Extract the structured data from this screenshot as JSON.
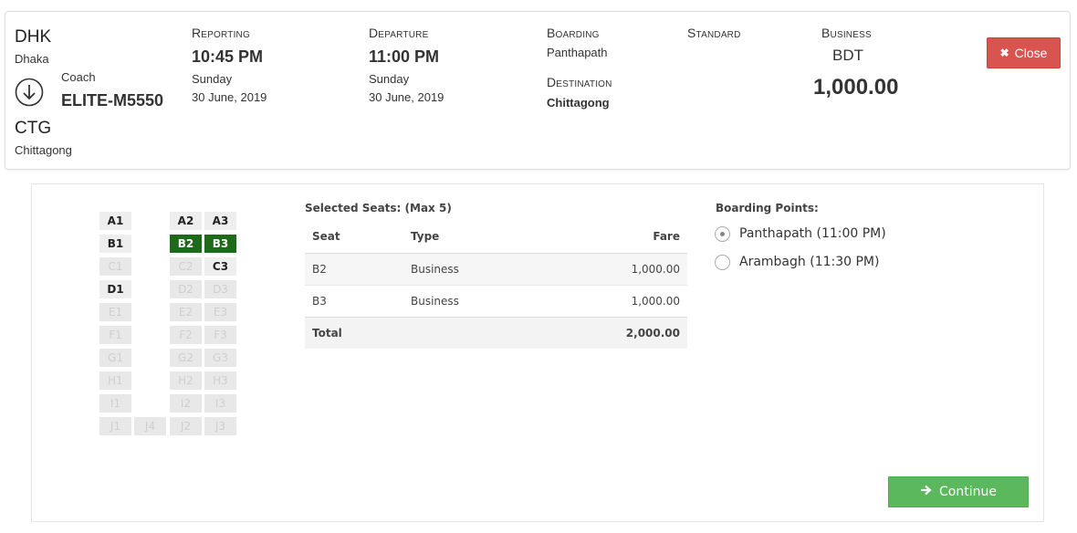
{
  "trip": {
    "origin": {
      "code": "DHK",
      "city": "Dhaka"
    },
    "destination": {
      "code": "CTG",
      "city": "Chittagong"
    },
    "coach": {
      "label": "Coach",
      "number": "ELITE-M5550"
    },
    "direction_icon": "arrow-down-circle-icon",
    "reporting": {
      "label": "Reporting",
      "time": "10:45 PM",
      "day": "Sunday",
      "date": "30 June, 2019"
    },
    "departure": {
      "label": "Departure",
      "time": "11:00 PM",
      "day": "Sunday",
      "date": "30 June, 2019"
    },
    "boarding": {
      "label": "Boarding",
      "value": "Panthapath"
    },
    "destination_point": {
      "label": "Destination",
      "value": "Chittagong"
    },
    "class_standard": "Standard",
    "class_business": "Business",
    "currency": "BDT",
    "price": "1,000.00",
    "close_button": {
      "icon": "close-icon",
      "label": "Close"
    }
  },
  "seat_map": {
    "colors": {
      "available": "#eeeeee",
      "selected": "#1e6a1a",
      "booked": "#e8e8e8"
    },
    "rows": [
      {
        "left": [
          "A1"
        ],
        "right": [
          "A2",
          "A3"
        ],
        "states": [
          "available",
          "available",
          "available"
        ]
      },
      {
        "left": [
          "B1"
        ],
        "right": [
          "B2",
          "B3"
        ],
        "states": [
          "available",
          "selected",
          "selected"
        ]
      },
      {
        "left": [
          "C1"
        ],
        "right": [
          "C2",
          "C3"
        ],
        "states": [
          "booked",
          "booked",
          "available"
        ]
      },
      {
        "left": [
          "D1"
        ],
        "right": [
          "D2",
          "D3"
        ],
        "states": [
          "available",
          "booked",
          "booked"
        ]
      },
      {
        "left": [
          "E1"
        ],
        "right": [
          "E2",
          "E3"
        ],
        "states": [
          "booked",
          "booked",
          "booked"
        ]
      },
      {
        "left": [
          "F1"
        ],
        "right": [
          "F2",
          "F3"
        ],
        "states": [
          "booked",
          "booked",
          "booked"
        ]
      },
      {
        "left": [
          "G1"
        ],
        "right": [
          "G2",
          "G3"
        ],
        "states": [
          "booked",
          "booked",
          "booked"
        ]
      },
      {
        "left": [
          "H1"
        ],
        "right": [
          "H2",
          "H3"
        ],
        "states": [
          "booked",
          "booked",
          "booked"
        ]
      },
      {
        "left": [
          "I1"
        ],
        "right": [
          "I2",
          "I3"
        ],
        "states": [
          "booked",
          "booked",
          "booked"
        ]
      },
      {
        "left": [
          "J1",
          "J4"
        ],
        "right": [
          "J2",
          "J3"
        ],
        "states": [
          "booked",
          "booked",
          "booked",
          "booked"
        ]
      }
    ]
  },
  "selected_seats": {
    "title": "Selected Seats: (Max 5)",
    "headers": {
      "seat": "Seat",
      "type": "Type",
      "fare": "Fare"
    },
    "rows": [
      {
        "seat": "B2",
        "type": "Business",
        "fare": "1,000.00"
      },
      {
        "seat": "B3",
        "type": "Business",
        "fare": "1,000.00"
      }
    ],
    "total_label": "Total",
    "total_value": "2,000.00"
  },
  "boarding_points": {
    "title": "Boarding Points:",
    "options": [
      {
        "label": "Panthapath (11:00 PM)",
        "checked": true
      },
      {
        "label": "Arambagh (11:30 PM)",
        "checked": false
      }
    ]
  },
  "continue_button": {
    "icon": "arrow-right-icon",
    "label": "Continue"
  }
}
